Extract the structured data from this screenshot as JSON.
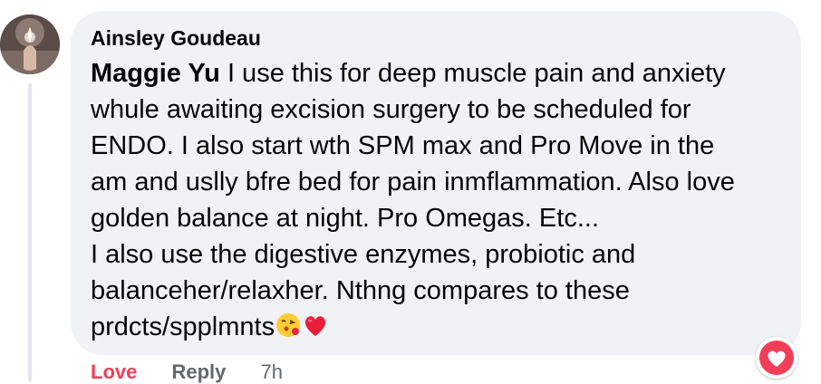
{
  "comment": {
    "author": "Ainsley Goudeau",
    "mention": "Maggie Yu",
    "lines": [
      " I use this for deep muscle pain and anxiety",
      "whule awaiting excision surgery to be scheduled for",
      "ENDO. I also start wth SPM max and Pro Move in the",
      "am and uslly bfre bed for pain inmflammation. Also love",
      "golden balance at night. Pro Omegas. Etc...",
      "I also use the digestive enzymes, probiotic and",
      "balanceher/relaxher. Nthng compares to these",
      "prdcts/spplmnts"
    ],
    "emojis": [
      "face-blowing-kiss-icon",
      "red-heart-icon"
    ],
    "reaction_icon": "heart-reaction-icon"
  },
  "actions": {
    "love": "Love",
    "reply": "Reply",
    "time": "7h"
  },
  "colors": {
    "bubble": "#f0f2f5",
    "text": "#050505",
    "secondary": "#65676b",
    "love": "#f33e58"
  }
}
